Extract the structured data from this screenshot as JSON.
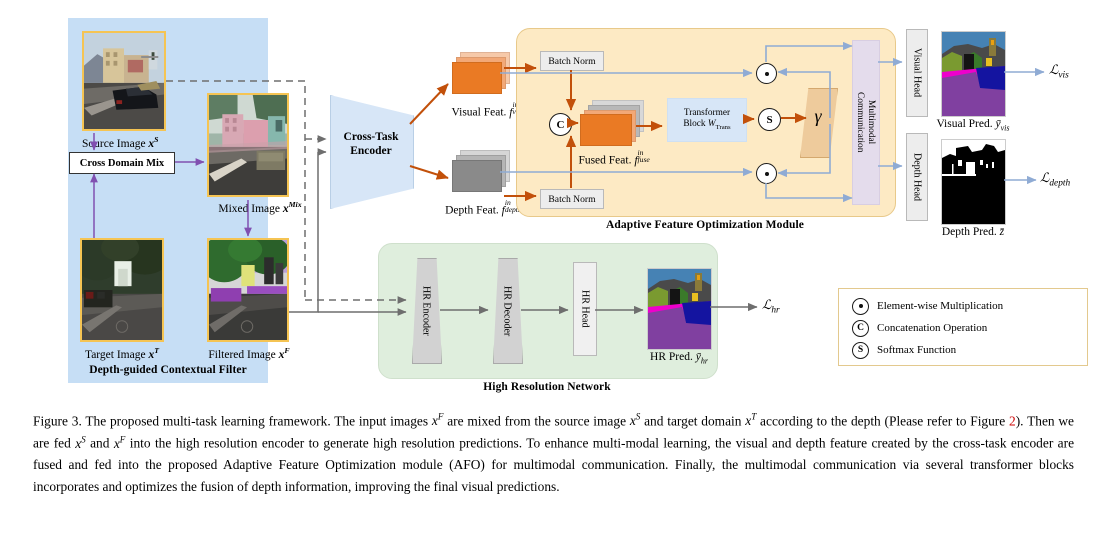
{
  "figure": {
    "number": "Figure 3.",
    "panels": {
      "dgcf": {
        "title": "Depth-guided Contextual Filter",
        "bg_color": "#c6def5",
        "images": [
          {
            "key": "source",
            "label": "Source Image",
            "symbol": "x",
            "sup": "S"
          },
          {
            "key": "mixed",
            "label": "Mixed Image",
            "symbol": "x",
            "sup": "Mix"
          },
          {
            "key": "target",
            "label": "Target Image",
            "symbol": "x",
            "sup": "T"
          },
          {
            "key": "filtered",
            "label": "Filtered Image",
            "symbol": "x",
            "sup": "F"
          }
        ],
        "mix_box": "Cross Domain Mix"
      },
      "encoder": {
        "label_line1": "Cross-Task",
        "label_line2": "Encoder",
        "color": "#d7e6f7"
      },
      "features": [
        {
          "key": "visual",
          "label": "Visual Feat.",
          "symbol": "f",
          "sub": "vis",
          "sup": "in",
          "color": "#ea7a24"
        },
        {
          "key": "depth",
          "label": "Depth Feat.",
          "symbol": "f",
          "sub": "depth",
          "sup": "in",
          "color": "#8a8a8a"
        }
      ],
      "afo": {
        "title": "Adaptive Feature Optimization Module",
        "bg_color": "#fdeac4",
        "batch_norm_top": "Batch Norm",
        "batch_norm_bottom": "Batch Norm",
        "concat_symbol": "C",
        "fused_label": "Fused Feat.",
        "fused_symbol": "f",
        "fused_sub": "fuse",
        "fused_sup": "in",
        "transformer_line1": "Transformer",
        "transformer_line2": "Block",
        "transformer_weight": "W",
        "transformer_weight_sub": "Trans",
        "softmax_symbol": "S",
        "gamma_symbol": "γ",
        "multimodal_line1": "Multimodal",
        "multimodal_line2": "Communication",
        "multimodal_color": "#e4dcec"
      },
      "heads": [
        {
          "key": "visual",
          "label": "Visual Head",
          "pred_label": "Visual Pred.",
          "pred_symbol": "ȳ",
          "pred_sub": "vis",
          "loss": "L",
          "loss_sub": "vis"
        },
        {
          "key": "depth",
          "label": "Depth Head",
          "pred_label": "Depth Pred.",
          "pred_symbol": "z̄",
          "pred_sub": "",
          "loss": "L",
          "loss_sub": "depth"
        }
      ],
      "hrn": {
        "title": "High Resolution Network",
        "bg_color": "#dfeedd",
        "blocks": [
          "HR Encoder",
          "HR Decoder",
          "HR Head"
        ],
        "pred_label": "HR Pred.",
        "pred_symbol": "ȳ",
        "pred_sub": "hr",
        "loss": "L",
        "loss_sub": "hr"
      },
      "legend": {
        "border_color": "#e3c98e",
        "items": [
          {
            "symbol": "·",
            "name": "dot-operator",
            "text": "Element-wise Multiplication"
          },
          {
            "symbol": "C",
            "name": "concat-operator",
            "text": "Concatenation Operation"
          },
          {
            "symbol": "S",
            "name": "softmax-operator",
            "text": "Softmax Function"
          }
        ]
      }
    }
  },
  "caption": {
    "part1": "Figure 3. The proposed multi-task learning framework. The input images ",
    "x_F_1": "x",
    "sup_F_1": "F",
    "part2": " are mixed from the source image ",
    "x_S_1": "x",
    "sup_S_1": "S",
    "part3": " and target domain ",
    "x_T_1": "x",
    "sup_T_1": "T",
    "part4": " according to the depth (Please refer to Figure ",
    "ref": "2",
    "part5": "). Then we are fed ",
    "x_S_2": "x",
    "sup_S_2": "S",
    "part6": " and ",
    "x_F_2": "x",
    "sup_F_2": "F",
    "part7": " into the high resolution encoder to generate high resolution predictions. To enhance multi-modal learning, the visual and depth feature created by the cross-task encoder are fused and fed into the proposed Adaptive Feature Optimization module (AFO) for multimodal communication. Finally, the multimodal communication via several transformer blocks incorporates and optimizes the fusion of depth information, improving the final visual predictions."
  },
  "colors": {
    "blue_panel": "#c6def5",
    "afo_panel": "#fdeac4",
    "hrn_panel": "#dfeedd",
    "orange_arrow": "#c2500a",
    "blue_arrow": "#8fabd4",
    "gray_arrow": "#6e6e6e",
    "purple_arrow": "#8050b0",
    "photo_border": "#f5c453",
    "orange_feature": "#ea7a24",
    "gray_feature": "#8a8a8a",
    "gamma_box": "#eecb9c"
  }
}
